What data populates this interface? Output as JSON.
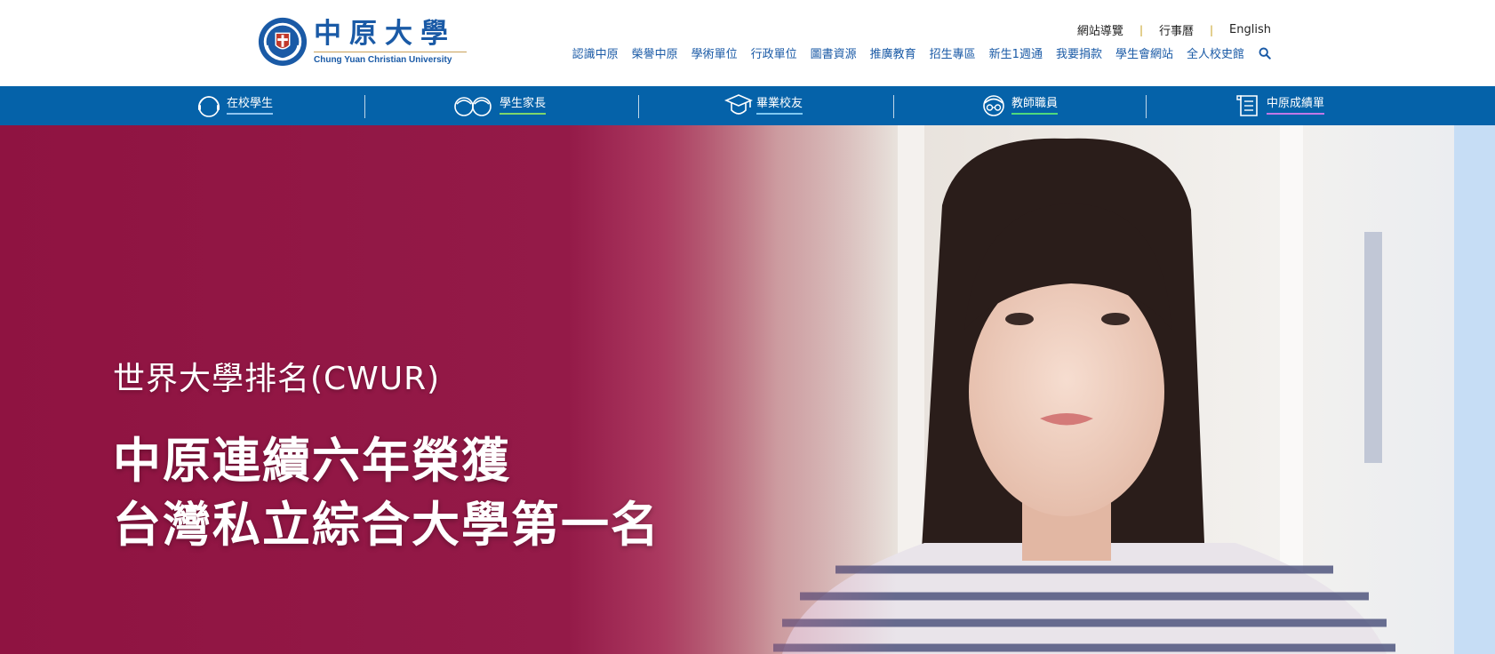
{
  "brand": {
    "name_cn": "中原大學",
    "name_en": "Chung Yuan Christian University",
    "primary_color": "#0562a9",
    "hero_color": "#8f1341"
  },
  "utility_nav": {
    "items": [
      "網站導覽",
      "行事曆",
      "English"
    ],
    "separator": "|"
  },
  "main_nav": {
    "items": [
      "認識中原",
      "榮譽中原",
      "學術單位",
      "行政單位",
      "圖書資源",
      "推廣教育",
      "招生專區",
      "新生1週通",
      "我要捐款",
      "學生會網站",
      "全人校史館"
    ],
    "search_icon": "search-icon"
  },
  "role_bar": {
    "items": [
      {
        "label": "在校學生",
        "icon": "student-face-icon",
        "accent": "#8fc4ef"
      },
      {
        "label": "學生家長",
        "icon": "parents-faces-icon",
        "accent": "#7fd66a"
      },
      {
        "label": "畢業校友",
        "icon": "graduate-cap-icon",
        "accent": "#7fc8f0"
      },
      {
        "label": "教師職員",
        "icon": "teacher-glasses-icon",
        "accent": "#4fd97c"
      },
      {
        "label": "中原成績單",
        "icon": "report-scroll-icon",
        "accent": "#c277e6"
      }
    ]
  },
  "hero": {
    "subtitle": "世界大學排名(CWUR)",
    "headline_line1": "中原連續六年榮獲",
    "headline_line2": "台灣私立綜合大學第一名"
  }
}
